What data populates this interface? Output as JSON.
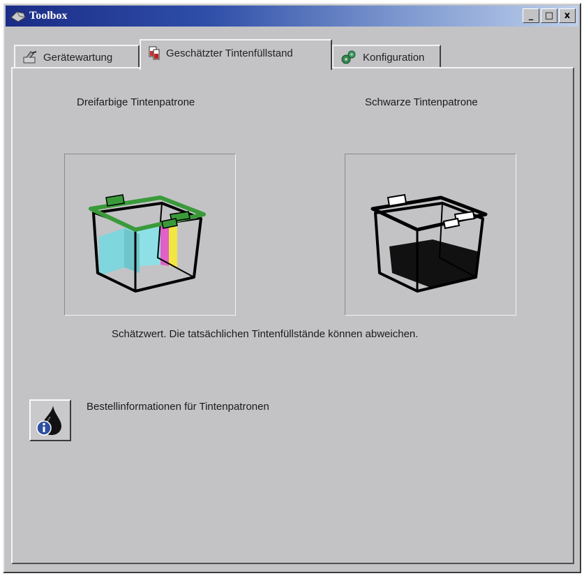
{
  "window": {
    "title": "Toolbox",
    "icon": "toolbox-icon",
    "controls": [
      "minimize",
      "maximize",
      "close"
    ],
    "control_glyphs": {
      "minimize": "_",
      "maximize": "□",
      "close": "x"
    }
  },
  "tabs": [
    {
      "label": "Gerätewartung",
      "icon": "maintenance-icon",
      "active": false
    },
    {
      "label": "Geschätzter Tintenfüllstand",
      "icon": "ink-level-icon",
      "active": true
    },
    {
      "label": "Konfiguration",
      "icon": "configuration-icon",
      "active": false
    }
  ],
  "cartridges": {
    "color": {
      "label": "Dreifarbige Tintenpatrone",
      "colors": [
        "#7fd6dc",
        "#e060c8",
        "#f2e640"
      ],
      "frame_color": "#3a9a3a"
    },
    "black": {
      "label": "Schwarze Tintenpatrone",
      "colors": [
        "#111111"
      ],
      "frame_color": "#000000"
    }
  },
  "disclaimer": "Schätzwert. Die tatsächlichen Tintenfüllstände können abweichen.",
  "order": {
    "label": "Bestellinformationen für Tintenpatronen",
    "icon": "ink-drop-info-icon"
  }
}
